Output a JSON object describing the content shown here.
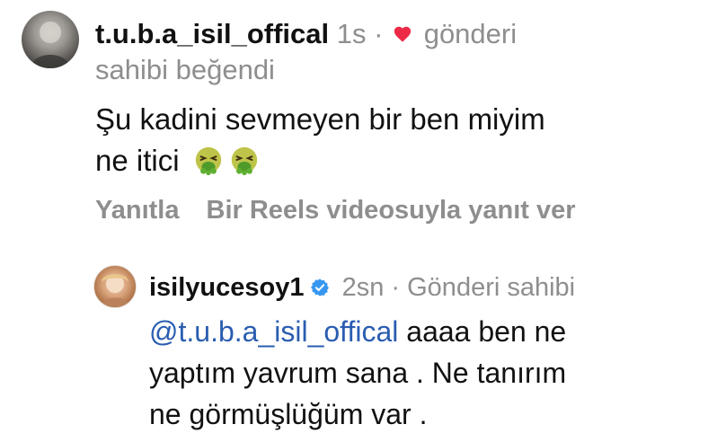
{
  "comment": {
    "username": "t.u.b.a_isil_offical",
    "time": "1s",
    "separator": "·",
    "liked_label_part1": "gönderi",
    "liked_label_part2": "sahibi beğendi",
    "text_line1": "Şu kadini sevmeyen bir ben miyim",
    "text_line2": "ne itici",
    "emojis": [
      "nauseated-face",
      "nauseated-face"
    ],
    "actions": {
      "reply": "Yanıtla",
      "reels_reply": "Bir Reels videosuyla yanıt ver"
    }
  },
  "reply": {
    "username": "isilyucesoy1",
    "verified": true,
    "time": "2sn",
    "separator": "·",
    "role": "Gönderi sahibi",
    "mention": "@t.u.b.a_isil_offical",
    "text_part1": "aaaa ben ne",
    "text_line2": "yaptım yavrum sana . Ne tanırım",
    "text_line3": "ne görmüşlüğüm var ."
  },
  "colors": {
    "text": "#111111",
    "meta": "#8e8e8e",
    "heart": "#ed2a47",
    "mention": "#2a5db0",
    "verified": "#3797f0"
  },
  "icons": [
    "heart-icon",
    "verified-badge-icon",
    "nauseated-face-emoji"
  ]
}
